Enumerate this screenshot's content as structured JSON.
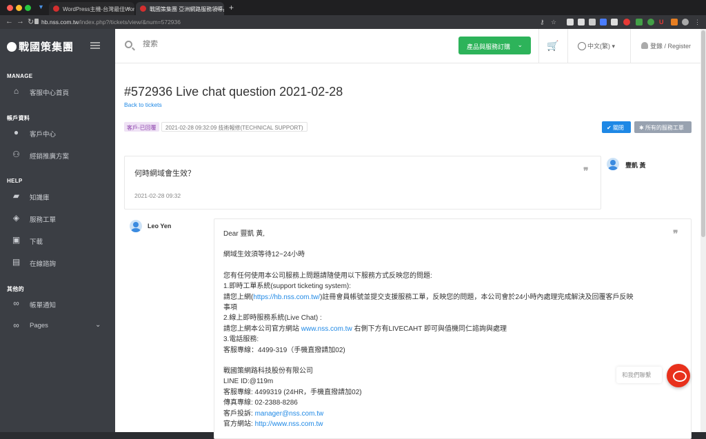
{
  "browser": {
    "tabs": [
      {
        "label": "WordPress主機-台灣最佳Wordp",
        "fav_color": "#d32f2f"
      },
      {
        "label": "戰國策集團 亞洲網路服務領導品",
        "fav_color": "#d32f2f"
      }
    ],
    "url_host": "hb.nss.com.tw",
    "url_path": "/index.php?/tickets/view/&num=572936",
    "new_tab": "+"
  },
  "sidebar": {
    "logo": "戰國策集團",
    "sections": [
      {
        "title": "MANAGE",
        "items": [
          {
            "label": "客服中心首頁",
            "icon": "home-icon"
          }
        ]
      },
      {
        "title": "帳戶資料",
        "items": [
          {
            "label": "客戶中心",
            "icon": "person-icon"
          },
          {
            "label": "經銷推廣方案",
            "icon": "group-add-icon"
          }
        ]
      },
      {
        "title": "HELP",
        "items": [
          {
            "label": "知識庫",
            "icon": "folder-icon"
          },
          {
            "label": "服務工單",
            "icon": "ticket-icon"
          },
          {
            "label": "下載",
            "icon": "save-icon"
          },
          {
            "label": "在線諮詢",
            "icon": "chat-icon"
          }
        ]
      },
      {
        "title": "其他的",
        "items": [
          {
            "label": "帳單通知",
            "icon": "link-icon"
          },
          {
            "label": "Pages",
            "icon": "link-icon"
          }
        ]
      }
    ]
  },
  "topbar": {
    "search_placeholder": "搜索",
    "products_button": "產品與服務訂購",
    "language": "中文(繁)",
    "login": "登錄 / Register"
  },
  "ticket": {
    "title": "#572936 Live chat question 2021-02-28",
    "back_link": "Back to tickets",
    "status_badge": "客戶-已回覆",
    "meta": "2021-02-28 09:32:09  技術報修(TECHNICAL SUPPORT)",
    "close_button": "關閉",
    "all_tickets_button": "所有的服務工單",
    "question": {
      "text": "何時網域會生效？",
      "timestamp": "2021-02-28 09:32",
      "author": "豐凱 黃"
    },
    "reply": {
      "author": "Leo Yen",
      "greeting": "Dear 豐凱 黃,",
      "line1": "網域生效須等待12~24小時",
      "intro": "您有任何使用本公司服務上問題請隨使用以下服務方式反映您的問題:",
      "s1_title": "1.即時工單系統(support ticketing system):",
      "s1_pre": "請您上網(",
      "s1_link": "https://hb.nss.com.tw/",
      "s1_post": ")註冊會員帳號並提交支援服務工單，反映您的問題，本公司會於24小時內處理完成解決及回覆客戶反映",
      "s1_tail": "事項",
      "s2_title": "2.線上即時服務系統(Live Chat) :",
      "s2_pre": "請您上網本公司官方網站 ",
      "s2_link": "www.nss.com.tw",
      "s2_post": " 右側下方有LIVECAHT 即可與值機同仁諮詢與處理",
      "s3_title": "3.電話服務:",
      "s3_text": "客服專線：4499-319（手機直撥請加02)",
      "company": "戰國策網路科技股份有限公司",
      "line_id": "LINE ID:@119m",
      "hotline": "客服專線: 4499319 (24HR，手機直撥請加02)",
      "fax": "傳真專線: 02-2388-8286",
      "complaint_pre": "客戶投訴: ",
      "complaint_link": "manager@nss.com.tw",
      "website_pre": "官方網站: ",
      "website_link": "http://www.nss.com.tw"
    }
  },
  "widget": {
    "contact_label": "和我們聯繫"
  },
  "colors": {
    "accent": "#1e88e5",
    "green": "#2db35a",
    "sidebar": "#3b3e44",
    "chat": "#e8311c"
  }
}
